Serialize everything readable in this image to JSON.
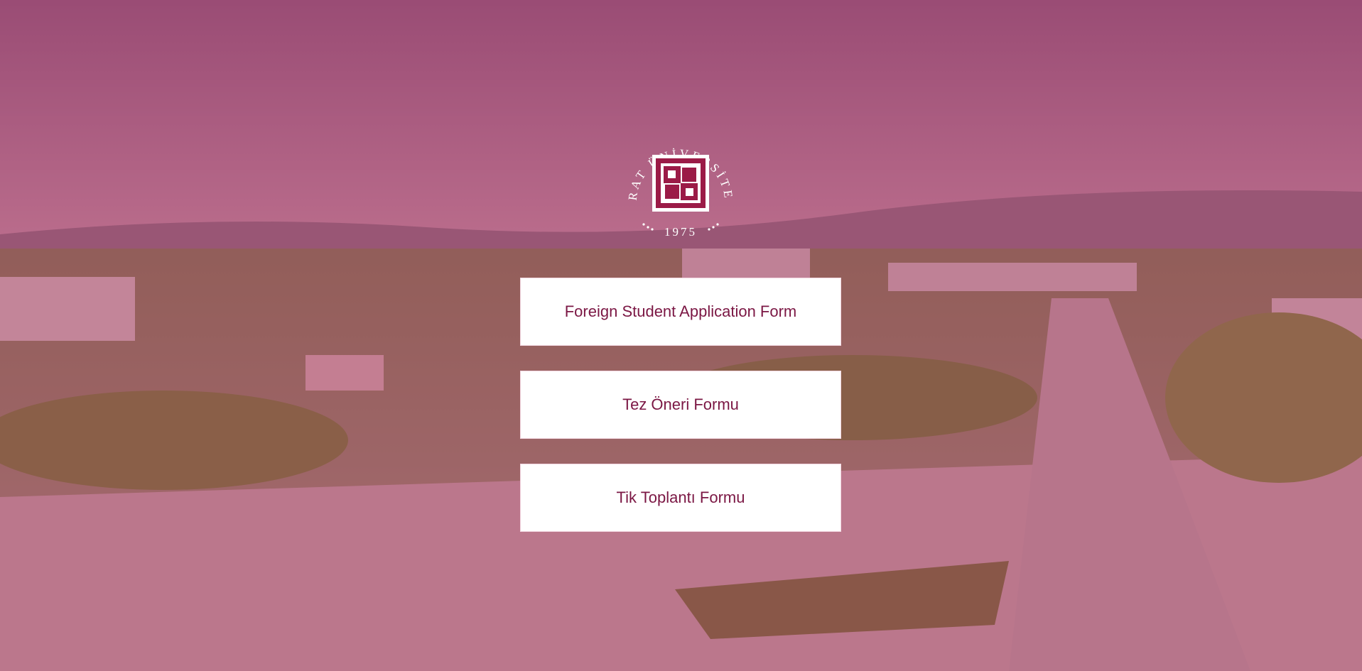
{
  "logo": {
    "arc_text": "FIRAT ÜNİVERSİTESİ",
    "year": "1975",
    "icon": "university-seal-icon",
    "color": "#9b1b47"
  },
  "overlay_color": "#aa285a",
  "forms": [
    {
      "label": "Foreign Student Application Form"
    },
    {
      "label": "Tez Öneri Formu"
    },
    {
      "label": "Tik Toplantı Formu"
    }
  ],
  "colors": {
    "button_bg": "#ffffff",
    "button_text": "#7b1744"
  }
}
